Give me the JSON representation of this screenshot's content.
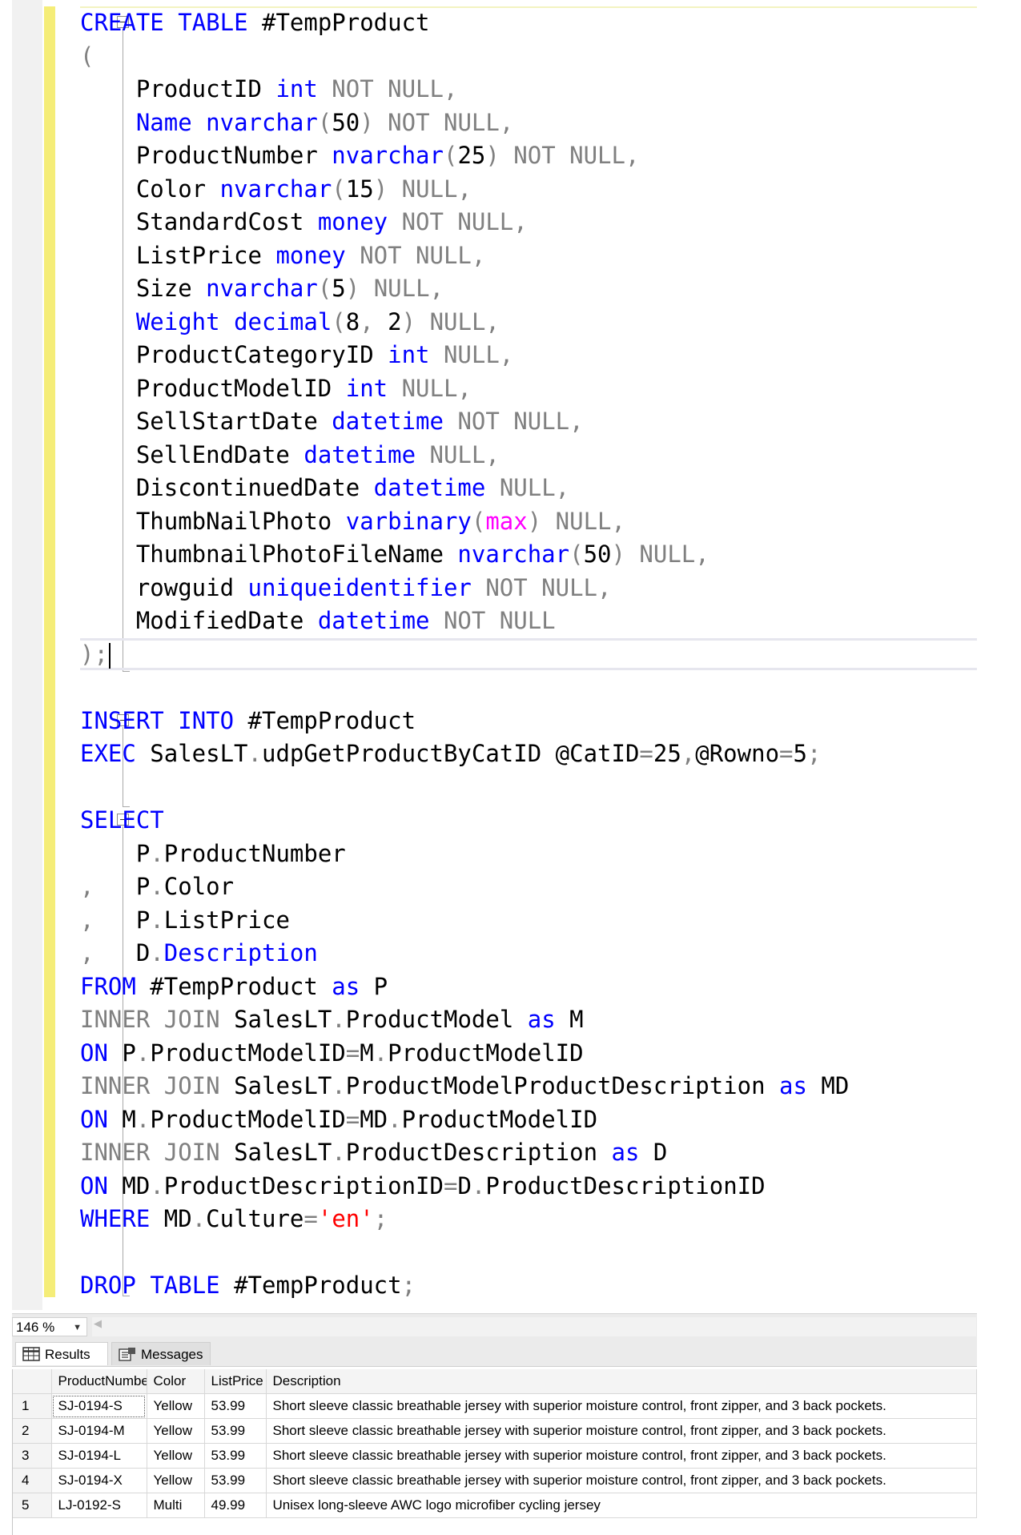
{
  "editor": {
    "lines": [
      [
        {
          "t": "CREATE",
          "c": "kw"
        },
        {
          "t": " "
        },
        {
          "t": "TABLE",
          "c": "kw"
        },
        {
          "t": " #TempProduct"
        }
      ],
      [
        {
          "t": "(",
          "c": "gr"
        }
      ],
      [
        {
          "t": "    ProductID "
        },
        {
          "t": "int",
          "c": "kw"
        },
        {
          "t": " "
        },
        {
          "t": "NOT NULL,",
          "c": "gr"
        }
      ],
      [
        {
          "t": "    "
        },
        {
          "t": "Name",
          "c": "kw"
        },
        {
          "t": " "
        },
        {
          "t": "nvarchar",
          "c": "kw"
        },
        {
          "t": "(",
          "c": "gr"
        },
        {
          "t": "50"
        },
        {
          "t": ")",
          "c": "gr"
        },
        {
          "t": " "
        },
        {
          "t": "NOT NULL,",
          "c": "gr"
        }
      ],
      [
        {
          "t": "    ProductNumber "
        },
        {
          "t": "nvarchar",
          "c": "kw"
        },
        {
          "t": "(",
          "c": "gr"
        },
        {
          "t": "25"
        },
        {
          "t": ")",
          "c": "gr"
        },
        {
          "t": " "
        },
        {
          "t": "NOT NULL,",
          "c": "gr"
        }
      ],
      [
        {
          "t": "    Color "
        },
        {
          "t": "nvarchar",
          "c": "kw"
        },
        {
          "t": "(",
          "c": "gr"
        },
        {
          "t": "15"
        },
        {
          "t": ")",
          "c": "gr"
        },
        {
          "t": " "
        },
        {
          "t": "NULL,",
          "c": "gr"
        }
      ],
      [
        {
          "t": "    StandardCost "
        },
        {
          "t": "money",
          "c": "kw"
        },
        {
          "t": " "
        },
        {
          "t": "NOT NULL,",
          "c": "gr"
        }
      ],
      [
        {
          "t": "    ListPrice "
        },
        {
          "t": "money",
          "c": "kw"
        },
        {
          "t": " "
        },
        {
          "t": "NOT NULL,",
          "c": "gr"
        }
      ],
      [
        {
          "t": "    Size "
        },
        {
          "t": "nvarchar",
          "c": "kw"
        },
        {
          "t": "(",
          "c": "gr"
        },
        {
          "t": "5"
        },
        {
          "t": ")",
          "c": "gr"
        },
        {
          "t": " "
        },
        {
          "t": "NULL,",
          "c": "gr"
        }
      ],
      [
        {
          "t": "    "
        },
        {
          "t": "Weight",
          "c": "kw"
        },
        {
          "t": " "
        },
        {
          "t": "decimal",
          "c": "kw"
        },
        {
          "t": "(",
          "c": "gr"
        },
        {
          "t": "8"
        },
        {
          "t": ",",
          "c": "gr"
        },
        {
          "t": " 2"
        },
        {
          "t": ")",
          "c": "gr"
        },
        {
          "t": " "
        },
        {
          "t": "NULL,",
          "c": "gr"
        }
      ],
      [
        {
          "t": "    ProductCategoryID "
        },
        {
          "t": "int",
          "c": "kw"
        },
        {
          "t": " "
        },
        {
          "t": "NULL,",
          "c": "gr"
        }
      ],
      [
        {
          "t": "    ProductModelID "
        },
        {
          "t": "int",
          "c": "kw"
        },
        {
          "t": " "
        },
        {
          "t": "NULL,",
          "c": "gr"
        }
      ],
      [
        {
          "t": "    SellStartDate "
        },
        {
          "t": "datetime",
          "c": "kw"
        },
        {
          "t": " "
        },
        {
          "t": "NOT NULL,",
          "c": "gr"
        }
      ],
      [
        {
          "t": "    SellEndDate "
        },
        {
          "t": "datetime",
          "c": "kw"
        },
        {
          "t": " "
        },
        {
          "t": "NULL,",
          "c": "gr"
        }
      ],
      [
        {
          "t": "    DiscontinuedDate "
        },
        {
          "t": "datetime",
          "c": "kw"
        },
        {
          "t": " "
        },
        {
          "t": "NULL,",
          "c": "gr"
        }
      ],
      [
        {
          "t": "    ThumbNailPhoto "
        },
        {
          "t": "varbinary",
          "c": "kw"
        },
        {
          "t": "(",
          "c": "gr"
        },
        {
          "t": "max",
          "c": "mg"
        },
        {
          "t": ")",
          "c": "gr"
        },
        {
          "t": " "
        },
        {
          "t": "NULL,",
          "c": "gr"
        }
      ],
      [
        {
          "t": "    ThumbnailPhotoFileName "
        },
        {
          "t": "nvarchar",
          "c": "kw"
        },
        {
          "t": "(",
          "c": "gr"
        },
        {
          "t": "50"
        },
        {
          "t": ")",
          "c": "gr"
        },
        {
          "t": " "
        },
        {
          "t": "NULL,",
          "c": "gr"
        }
      ],
      [
        {
          "t": "    rowguid "
        },
        {
          "t": "uniqueidentifier",
          "c": "kw"
        },
        {
          "t": " "
        },
        {
          "t": "NOT NULL,",
          "c": "gr"
        }
      ],
      [
        {
          "t": "    ModifiedDate "
        },
        {
          "t": "datetime",
          "c": "kw"
        },
        {
          "t": " "
        },
        {
          "t": "NOT NULL",
          "c": "gr"
        }
      ],
      [
        {
          "t": ");",
          "c": "gr"
        },
        {
          "cursor": true
        }
      ],
      [],
      [
        {
          "t": "INSERT",
          "c": "kw"
        },
        {
          "t": " "
        },
        {
          "t": "INTO",
          "c": "kw"
        },
        {
          "t": " #TempProduct"
        }
      ],
      [
        {
          "t": "EXEC",
          "c": "kw"
        },
        {
          "t": " SalesLT"
        },
        {
          "t": ".",
          "c": "gr"
        },
        {
          "t": "udpGetProductByCatID @CatID"
        },
        {
          "t": "=",
          "c": "gr"
        },
        {
          "t": "25"
        },
        {
          "t": ",",
          "c": "gr"
        },
        {
          "t": "@Rowno"
        },
        {
          "t": "=",
          "c": "gr"
        },
        {
          "t": "5"
        },
        {
          "t": ";",
          "c": "gr"
        }
      ],
      [],
      [
        {
          "t": "SELECT",
          "c": "kw"
        }
      ],
      [
        {
          "t": "    P"
        },
        {
          "t": ".",
          "c": "gr"
        },
        {
          "t": "ProductNumber"
        }
      ],
      [
        {
          "t": ",",
          "c": "gr"
        },
        {
          "t": "   P"
        },
        {
          "t": ".",
          "c": "gr"
        },
        {
          "t": "Color"
        }
      ],
      [
        {
          "t": ",",
          "c": "gr"
        },
        {
          "t": "   P"
        },
        {
          "t": ".",
          "c": "gr"
        },
        {
          "t": "ListPrice"
        }
      ],
      [
        {
          "t": ",",
          "c": "gr"
        },
        {
          "t": "   D"
        },
        {
          "t": ".",
          "c": "gr"
        },
        {
          "t": "Description",
          "c": "kw"
        }
      ],
      [
        {
          "t": "FROM",
          "c": "kw"
        },
        {
          "t": " #TempProduct "
        },
        {
          "t": "as",
          "c": "kw"
        },
        {
          "t": " P"
        }
      ],
      [
        {
          "t": "INNER JOIN",
          "c": "gr"
        },
        {
          "t": " SalesLT"
        },
        {
          "t": ".",
          "c": "gr"
        },
        {
          "t": "ProductModel "
        },
        {
          "t": "as",
          "c": "kw"
        },
        {
          "t": " M"
        }
      ],
      [
        {
          "t": "ON",
          "c": "kw"
        },
        {
          "t": " P"
        },
        {
          "t": ".",
          "c": "gr"
        },
        {
          "t": "ProductModelID"
        },
        {
          "t": "=",
          "c": "gr"
        },
        {
          "t": "M"
        },
        {
          "t": ".",
          "c": "gr"
        },
        {
          "t": "ProductModelID"
        }
      ],
      [
        {
          "t": "INNER JOIN",
          "c": "gr"
        },
        {
          "t": " SalesLT"
        },
        {
          "t": ".",
          "c": "gr"
        },
        {
          "t": "ProductModelProductDescription "
        },
        {
          "t": "as",
          "c": "kw"
        },
        {
          "t": " MD"
        }
      ],
      [
        {
          "t": "ON",
          "c": "kw"
        },
        {
          "t": " M"
        },
        {
          "t": ".",
          "c": "gr"
        },
        {
          "t": "ProductModelID"
        },
        {
          "t": "=",
          "c": "gr"
        },
        {
          "t": "MD"
        },
        {
          "t": ".",
          "c": "gr"
        },
        {
          "t": "ProductModelID"
        }
      ],
      [
        {
          "t": "INNER JOIN",
          "c": "gr"
        },
        {
          "t": " SalesLT"
        },
        {
          "t": ".",
          "c": "gr"
        },
        {
          "t": "ProductDescription "
        },
        {
          "t": "as",
          "c": "kw"
        },
        {
          "t": " D"
        }
      ],
      [
        {
          "t": "ON",
          "c": "kw"
        },
        {
          "t": " MD"
        },
        {
          "t": ".",
          "c": "gr"
        },
        {
          "t": "ProductDescriptionID"
        },
        {
          "t": "=",
          "c": "gr"
        },
        {
          "t": "D"
        },
        {
          "t": ".",
          "c": "gr"
        },
        {
          "t": "ProductDescriptionID"
        }
      ],
      [
        {
          "t": "WHERE",
          "c": "kw"
        },
        {
          "t": " MD"
        },
        {
          "t": ".",
          "c": "gr"
        },
        {
          "t": "Culture"
        },
        {
          "t": "=",
          "c": "gr"
        },
        {
          "t": "'en'",
          "c": "st"
        },
        {
          "t": ";",
          "c": "gr"
        }
      ],
      [],
      [
        {
          "t": "DROP",
          "c": "kw"
        },
        {
          "t": " "
        },
        {
          "t": "TABLE",
          "c": "kw"
        },
        {
          "t": " #TempProduct"
        },
        {
          "t": ";",
          "c": "gr"
        }
      ]
    ]
  },
  "zoom": {
    "value": "146 %"
  },
  "tabs": {
    "results": "Results",
    "messages": "Messages"
  },
  "results": {
    "columns": [
      "",
      "ProductNumber",
      "Color",
      "ListPrice",
      "Description"
    ],
    "rows": [
      [
        "1",
        "SJ-0194-S",
        "Yellow",
        "53.99",
        "Short sleeve classic breathable jersey with superior moisture control, front zipper, and 3 back pockets."
      ],
      [
        "2",
        "SJ-0194-M",
        "Yellow",
        "53.99",
        "Short sleeve classic breathable jersey with superior moisture control, front zipper, and 3 back pockets."
      ],
      [
        "3",
        "SJ-0194-L",
        "Yellow",
        "53.99",
        "Short sleeve classic breathable jersey with superior moisture control, front zipper, and 3 back pockets."
      ],
      [
        "4",
        "SJ-0194-X",
        "Yellow",
        "53.99",
        "Short sleeve classic breathable jersey with superior moisture control, front zipper, and 3 back pockets."
      ],
      [
        "5",
        "LJ-0192-S",
        "Multi",
        "49.99",
        "Unisex long-sleeve AWC logo microfiber cycling jersey"
      ]
    ]
  },
  "colors": {
    "keyword": "#0000ff",
    "operator": "#808080",
    "string": "#ff0000",
    "function": "#ff00ff",
    "change_bar": "#f5ed78"
  }
}
